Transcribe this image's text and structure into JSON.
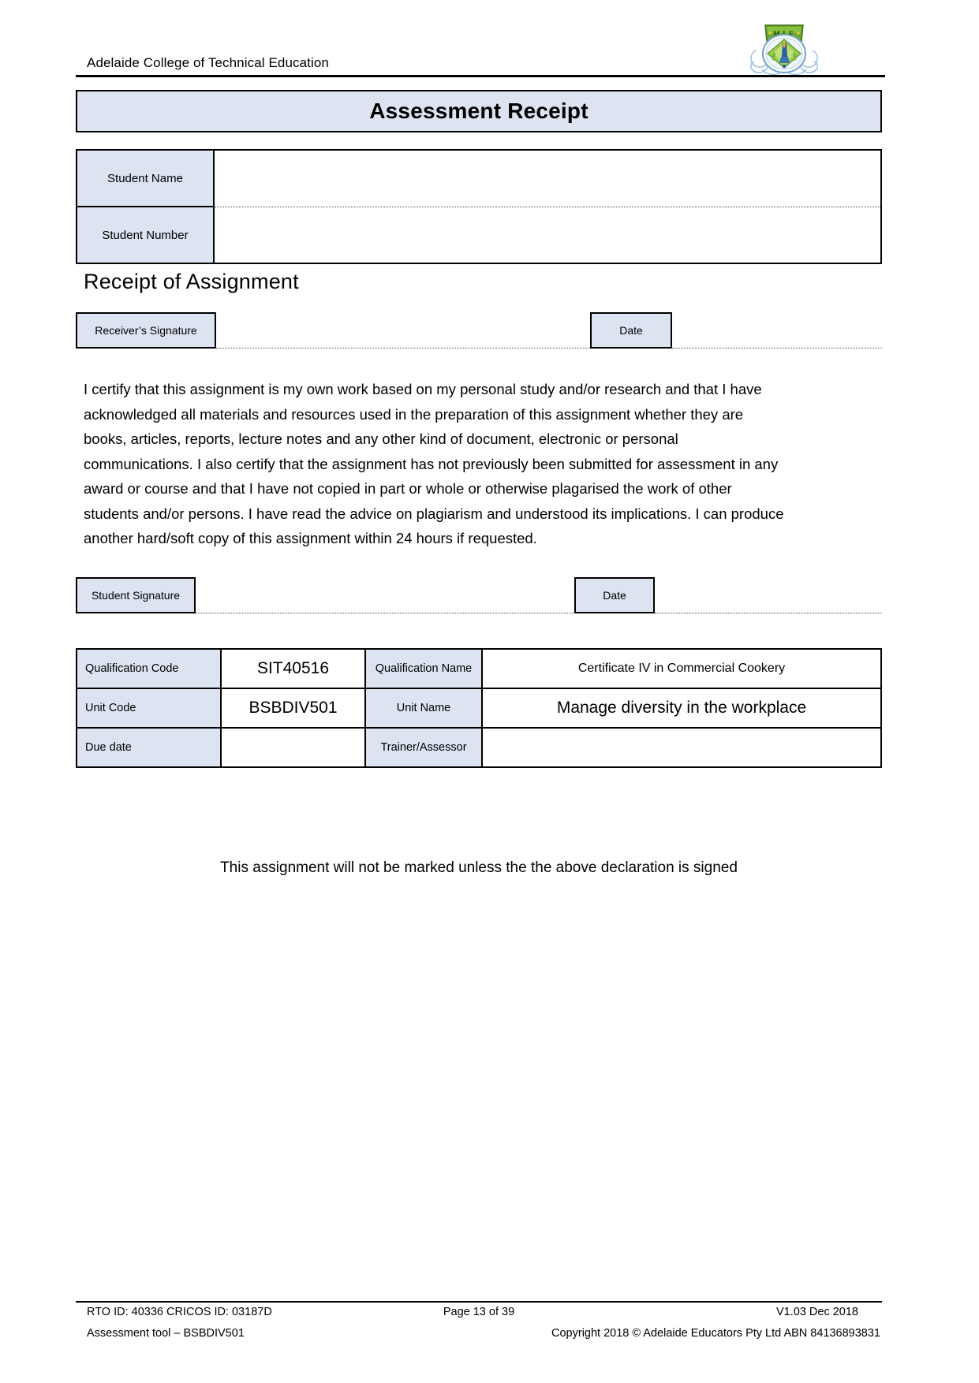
{
  "header": {
    "organisation": "Adelaide College of Technical Education",
    "logo_alt": "college-crest-logo"
  },
  "title": {
    "text": "Assessment Receipt"
  },
  "student_table": {
    "rows": [
      {
        "label": "Student Name",
        "value": ""
      },
      {
        "label": "Student Number",
        "value": ""
      }
    ]
  },
  "receipt_section": {
    "heading": "Receipt of Assignment",
    "signature_label": "Receiver’s Signature",
    "date_label": "Date",
    "signature_value": "",
    "date_value": ""
  },
  "declaration": {
    "text": "I certify that this assignment is my own work based on my personal study and/or research and that I have acknowledged all materials and resources used in the preparation of this assignment whether they are books, articles, reports, lecture notes and any other kind of document, electronic or personal communications. I also certify that the assignment has not previously been submitted for assessment in any award or course and that I have not copied in part or whole or otherwise plagarised the work of other students and/or persons. I have read the advice on plagiarism and understood its implications. I can produce another hard/soft copy of this assignment within 24 hours if requested."
  },
  "student_signature_section": {
    "signature_label": "Student Signature",
    "date_label": "Date",
    "signature_value": "",
    "date_value": ""
  },
  "qualification_table": {
    "rows": [
      {
        "key_left": "Qualification Code",
        "value_left": "SIT40516",
        "key_mid": "Qualification Name",
        "value_right": "Certificate IV in Commercial Cookery"
      },
      {
        "key_left": "Unit Code",
        "value_left": "BSBDIV501",
        "key_mid": "Unit Name",
        "value_right": "Manage diversity in the workplace"
      },
      {
        "key_left": "Due date",
        "value_left": "",
        "key_mid": "Trainer/Assessor",
        "value_right": ""
      }
    ]
  },
  "notice": {
    "text": "This assignment will not be marked unless the the above declaration is signed"
  },
  "footer": {
    "row1_left": "RTO ID: 40336 CRICOS ID: 03187D",
    "row1_center": "Page 13 of 39",
    "row1_right": "V1.03 Dec 2018",
    "row2_left": "Assessment tool – BSBDIV501",
    "row2_right": "Copyright 2018 © Adelaide Educators Pty Ltd ABN 84136893831"
  },
  "colors": {
    "cell_fill": "#dce4f1",
    "border": "#000000",
    "text": "#000000"
  }
}
